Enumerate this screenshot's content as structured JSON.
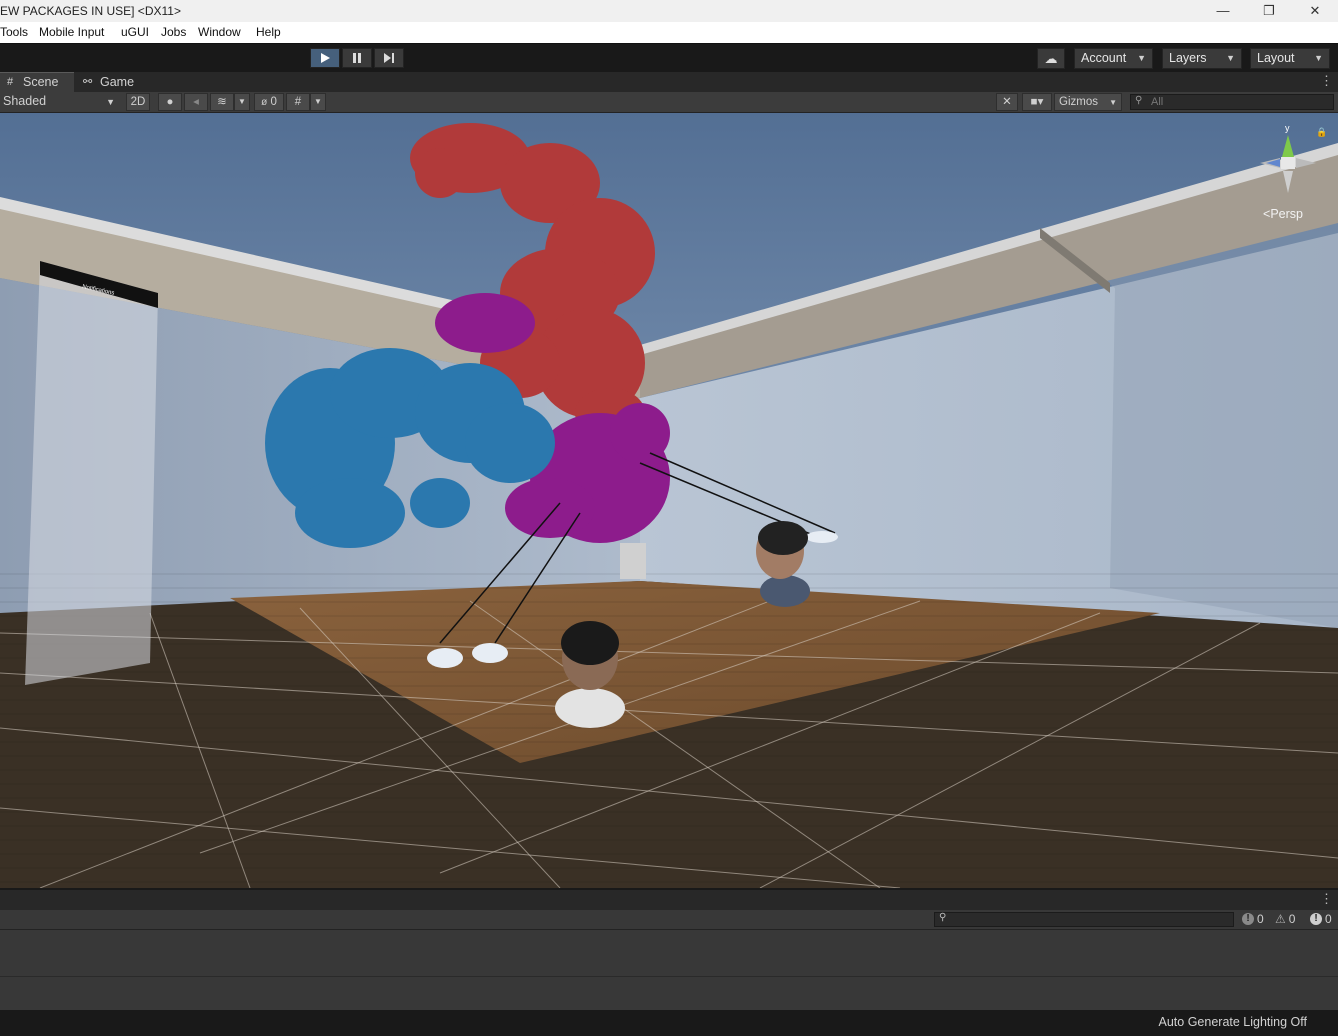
{
  "window": {
    "title": "EW PACKAGES IN USE] <DX11>",
    "minimize": "—",
    "restore": "❐",
    "close": "✕"
  },
  "menu": [
    "Tools",
    "Mobile Input",
    "uGUI",
    "Jobs",
    "Window",
    "Help"
  ],
  "toolbar": {
    "play_icon": "play-icon",
    "pause_icon": "pause-icon",
    "step_icon": "step-icon",
    "account": "Account",
    "layers": "Layers",
    "layout": "Layout"
  },
  "tabs": [
    {
      "label": "Scene",
      "icon": "grid-icon"
    },
    {
      "label": "Game",
      "icon": "gamepad-icon"
    }
  ],
  "scene_toolbar": {
    "shading_mode": "Shaded",
    "mode_2d": "2D",
    "hidden_count": "0",
    "gizmos": "Gizmos",
    "search_placeholder": "All"
  },
  "viewport": {
    "projection_label": "Persp",
    "axis_y": "y",
    "notification_panel_title": "Notifications"
  },
  "console": {
    "search_placeholder": "",
    "info_count": "0",
    "warning_count": "0",
    "error_count": "0"
  },
  "status": {
    "lighting": "Auto Generate Lighting Off"
  },
  "colors": {
    "play_active": "#46607c",
    "editor_dark": "#191919",
    "panel": "#383838"
  }
}
